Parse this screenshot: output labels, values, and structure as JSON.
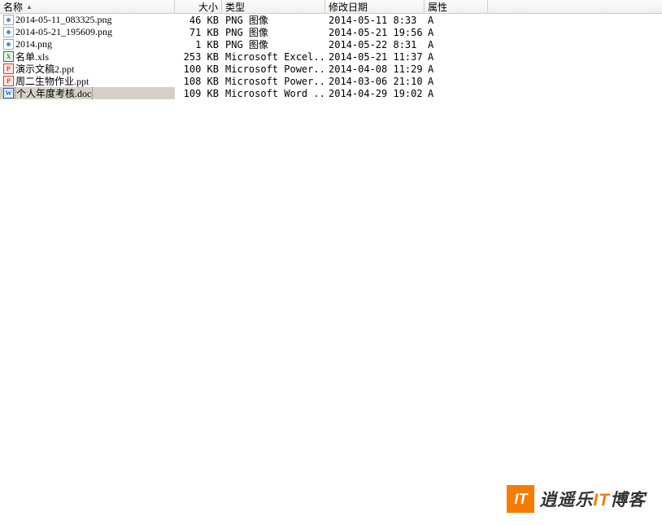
{
  "columns": {
    "name": "名称",
    "size": "大小",
    "type": "类型",
    "date": "修改日期",
    "attr": "属性"
  },
  "sort_indicator": "▲",
  "files": [
    {
      "icon": "png",
      "name": "2014-05-11_083325.png",
      "size": "46 KB",
      "type": "PNG 图像",
      "date": "2014-05-11 8:33",
      "attr": "A",
      "selected": false
    },
    {
      "icon": "png",
      "name": "2014-05-21_195609.png",
      "size": "71 KB",
      "type": "PNG 图像",
      "date": "2014-05-21 19:56",
      "attr": "A",
      "selected": false
    },
    {
      "icon": "png",
      "name": "2014.png",
      "size": "1 KB",
      "type": "PNG 图像",
      "date": "2014-05-22 8:31",
      "attr": "A",
      "selected": false
    },
    {
      "icon": "xls",
      "name": "名单.xls",
      "size": "253 KB",
      "type": "Microsoft Excel...",
      "date": "2014-05-21 11:37",
      "attr": "A",
      "selected": false
    },
    {
      "icon": "ppt",
      "name": "演示文稿2.ppt",
      "size": "100 KB",
      "type": "Microsoft Power...",
      "date": "2014-04-08 11:29",
      "attr": "A",
      "selected": false
    },
    {
      "icon": "ppt",
      "name": "周二生物作业.ppt",
      "size": "108 KB",
      "type": "Microsoft Power...",
      "date": "2014-03-06 21:10",
      "attr": "A",
      "selected": false
    },
    {
      "icon": "doc",
      "name": "个人年度考核.doc",
      "size": "109 KB",
      "type": "Microsoft Word ...",
      "date": "2014-04-29 19:02",
      "attr": "A",
      "selected": true
    }
  ],
  "watermark": {
    "box": "IT",
    "text1": "逍遥乐",
    "text2": "IT",
    "text3": "博客"
  }
}
